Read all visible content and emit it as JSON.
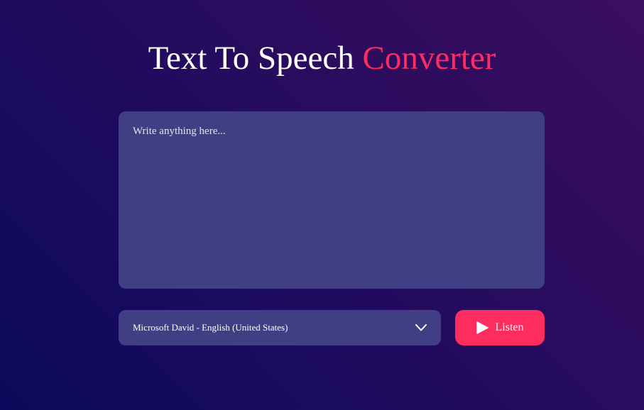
{
  "header": {
    "title_main": "Text To Speech",
    "title_accent": "Converter"
  },
  "editor": {
    "placeholder": "Write anything here...",
    "value": ""
  },
  "voice_select": {
    "selected": "Microsoft David - English (United States)",
    "icon": "chevron-down-icon"
  },
  "listen_button": {
    "label": "Listen",
    "icon": "play-icon"
  },
  "colors": {
    "accent": "#ff2c5f",
    "panel": "#403f83",
    "background_start": "#0c0a5c",
    "background_end": "#3b0e62"
  }
}
